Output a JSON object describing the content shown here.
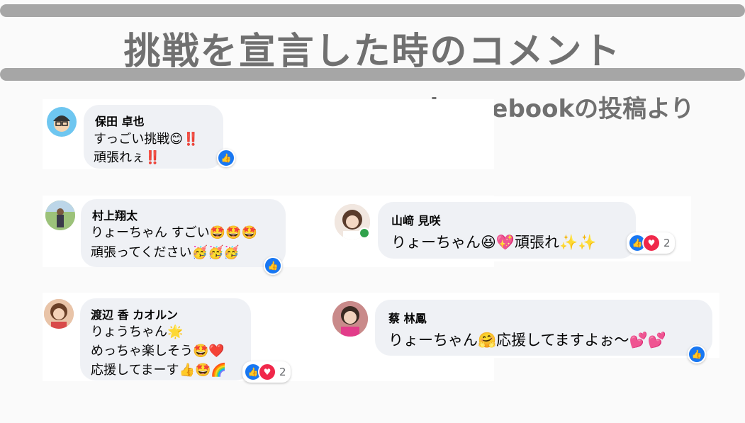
{
  "header": {
    "title": "挑戦を宣言した時のコメント",
    "source": "※Facebookの投稿より"
  },
  "colors": {
    "bar": "#a6a6a6",
    "bubble": "#eff1f5",
    "like": "#1877f2",
    "love": "#f0284a"
  },
  "comments": [
    {
      "name": "保田 卓也",
      "lines": [
        "すっごい挑戦😊‼️",
        "頑張れぇ‼️"
      ],
      "reactions": [
        "like-icon"
      ],
      "count": ""
    },
    {
      "name": "村上翔太",
      "lines": [
        "りょーちゃん すごい🤩🤩🤩",
        "頑張ってください🥳🥳🥳"
      ],
      "reactions": [
        "like-icon"
      ],
      "count": ""
    },
    {
      "name": "山﨑 見咲",
      "lines": [
        "りょーちゃん😆💖頑張れ✨✨"
      ],
      "reactions": [
        "like-icon",
        "heart-icon"
      ],
      "count": "2"
    },
    {
      "name": "渡辺 香 カオルン",
      "lines": [
        "りょうちゃん🌟",
        "めっちゃ楽しそう🤩❤️",
        "応援してまーす👍🤩🌈"
      ],
      "reactions": [
        "like-icon",
        "heart-icon"
      ],
      "count": "2"
    },
    {
      "name": "蔡 林鳳",
      "lines": [
        "りょーちゃん🤗応援してますよぉ〜💕💕"
      ],
      "reactions": [
        "like-icon"
      ],
      "count": ""
    }
  ]
}
